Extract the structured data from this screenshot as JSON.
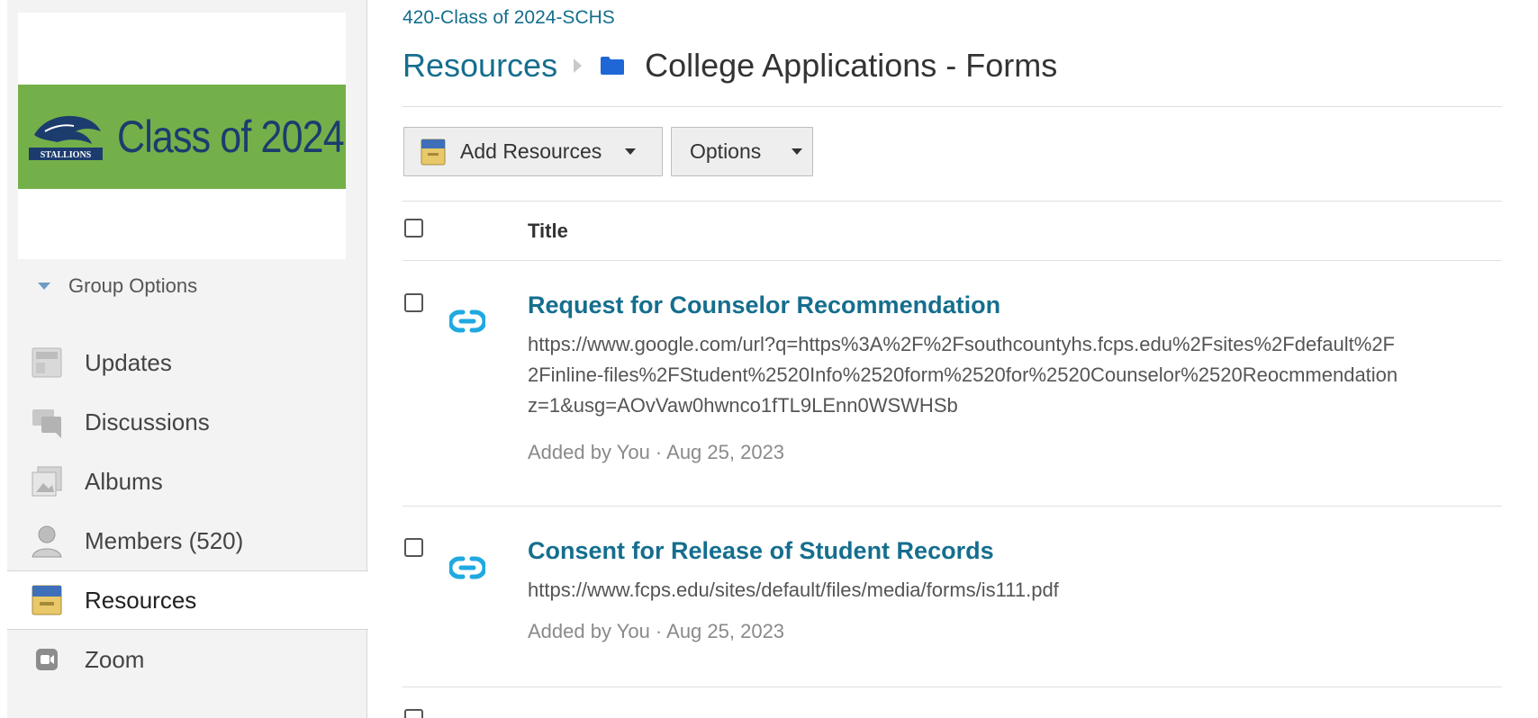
{
  "sidebar": {
    "banner_title": "Class of 2024",
    "group_options_label": "Group Options",
    "items": [
      {
        "label": "Updates",
        "icon": "updates-icon"
      },
      {
        "label": "Discussions",
        "icon": "discussions-icon"
      },
      {
        "label": "Albums",
        "icon": "albums-icon"
      },
      {
        "label": "Members (520)",
        "icon": "members-icon"
      },
      {
        "label": "Resources",
        "icon": "resources-icon",
        "active": true
      },
      {
        "label": "Zoom",
        "icon": "zoom-icon"
      }
    ]
  },
  "header": {
    "course_name": "420-Class of 2024-SCHS",
    "breadcrumb_root": "Resources",
    "breadcrumb_current": "College Applications - Forms"
  },
  "toolbar": {
    "add_resources_label": "Add Resources",
    "options_label": "Options"
  },
  "table": {
    "title_header": "Title"
  },
  "resources": [
    {
      "title": "Request for Counselor Recommendation",
      "url_lines": [
        "https://www.google.com/url?q=https%3A%2F%2Fsouthcountyhs.fcps.edu%2Fsites%2Fdefault%2F",
        "2Finline-files%2FStudent%2520Info%2520form%2520for%2520Counselor%2520Reocmmendation",
        "z=1&usg=AOvVaw0hwnco1fTL9LEnn0WSWHSb"
      ],
      "meta": "Added by You · Aug 25, 2023",
      "icon": "link-icon"
    },
    {
      "title": "Consent for Release of Student Records",
      "url_lines": [
        "https://www.fcps.edu/sites/default/files/media/forms/is111.pdf"
      ],
      "meta": "Added by You · Aug 25, 2023",
      "icon": "link-icon"
    }
  ],
  "colors": {
    "accent": "#156e8e",
    "link_icon": "#1fa9e0",
    "banner_green": "#74b04a",
    "banner_text": "#1c3c6e"
  }
}
